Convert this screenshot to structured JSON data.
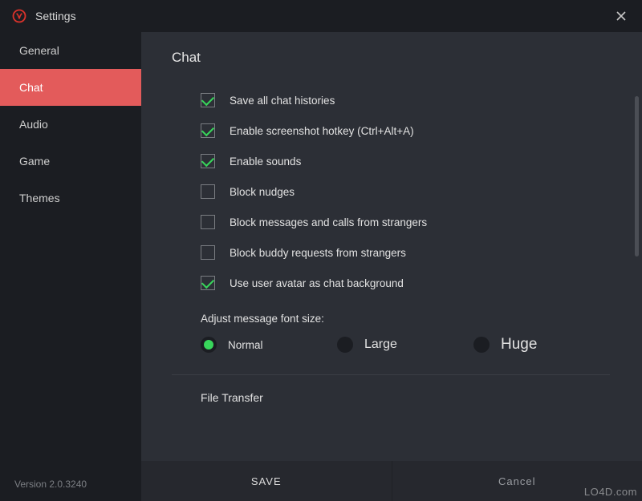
{
  "titlebar": {
    "title": "Settings"
  },
  "sidebar": {
    "items": [
      {
        "label": "General",
        "active": false
      },
      {
        "label": "Chat",
        "active": true
      },
      {
        "label": "Audio",
        "active": false
      },
      {
        "label": "Game",
        "active": false
      },
      {
        "label": "Themes",
        "active": false
      }
    ],
    "version": "Version 2.0.3240"
  },
  "page": {
    "title": "Chat",
    "options": [
      {
        "label": "Save all chat histories",
        "checked": true
      },
      {
        "label": "Enable screenshot hotkey (Ctrl+Alt+A)",
        "checked": true
      },
      {
        "label": "Enable sounds",
        "checked": true
      },
      {
        "label": "Block nudges",
        "checked": false
      },
      {
        "label": "Block messages and calls from strangers",
        "checked": false
      },
      {
        "label": "Block buddy requests from strangers",
        "checked": false
      },
      {
        "label": "Use user avatar as chat background",
        "checked": true
      }
    ],
    "fontSize": {
      "title": "Adjust message font size:",
      "options": [
        {
          "label": "Normal",
          "selected": true,
          "sizeClass": "normal"
        },
        {
          "label": "Large",
          "selected": false,
          "sizeClass": "large"
        },
        {
          "label": "Huge",
          "selected": false,
          "sizeClass": "huge"
        }
      ]
    },
    "nextSection": "File Transfer"
  },
  "footer": {
    "save": "SAVE",
    "cancel": "Cancel"
  },
  "watermark": "LO4D.com"
}
